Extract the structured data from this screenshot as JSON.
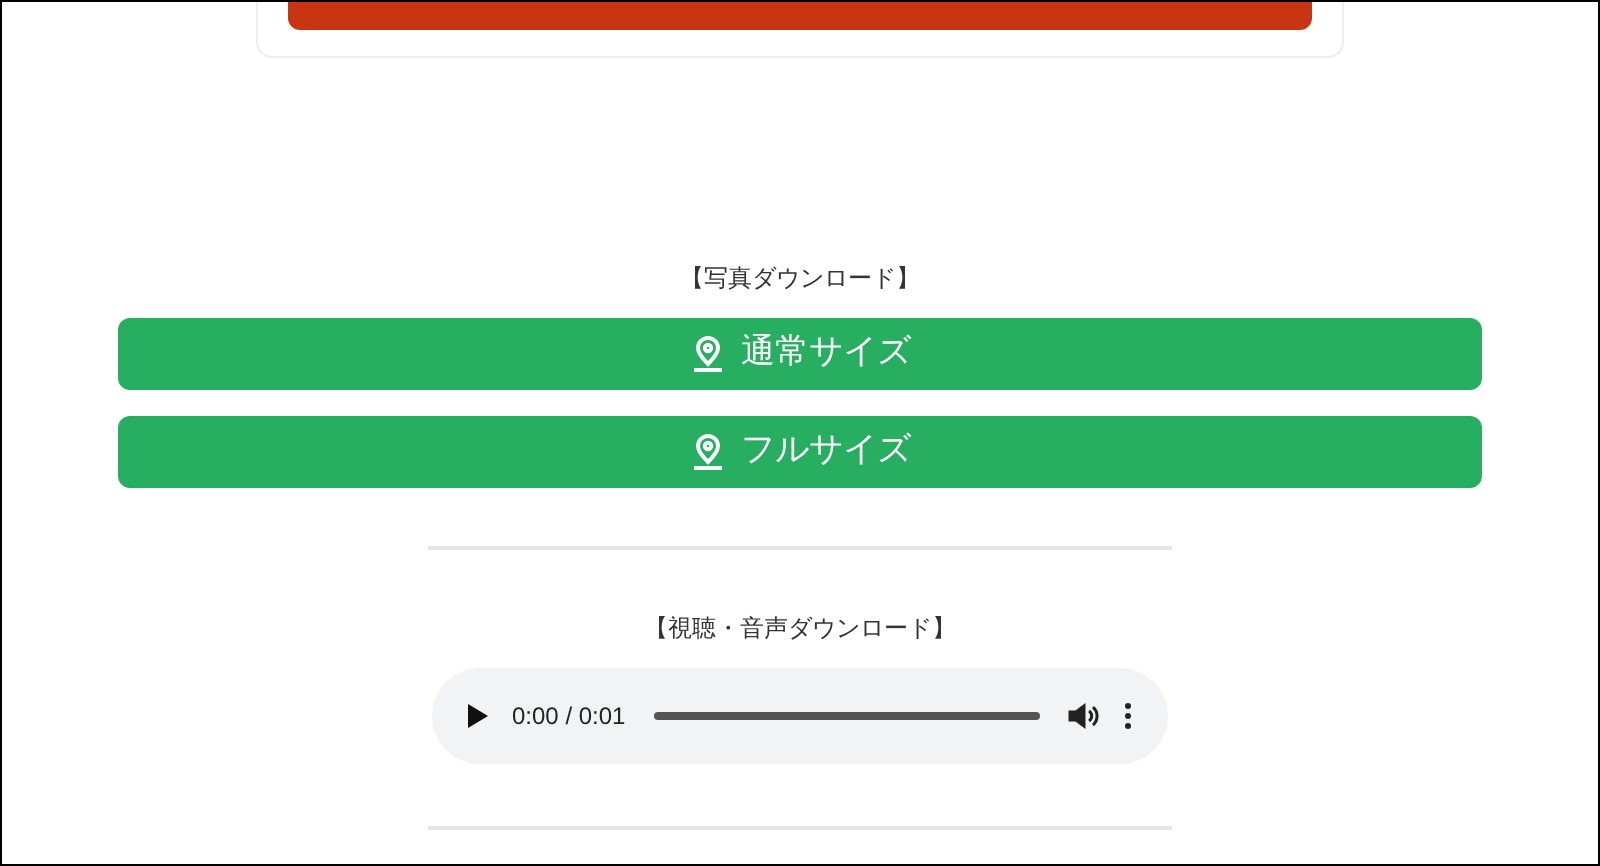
{
  "photo_section": {
    "heading": "【写真ダウンロード】",
    "buttons": [
      {
        "label": "通常サイズ"
      },
      {
        "label": "フルサイズ"
      }
    ]
  },
  "audio_section": {
    "heading": "【視聴・音声ダウンロード】",
    "player": {
      "time": "0:00 / 0:01"
    }
  }
}
